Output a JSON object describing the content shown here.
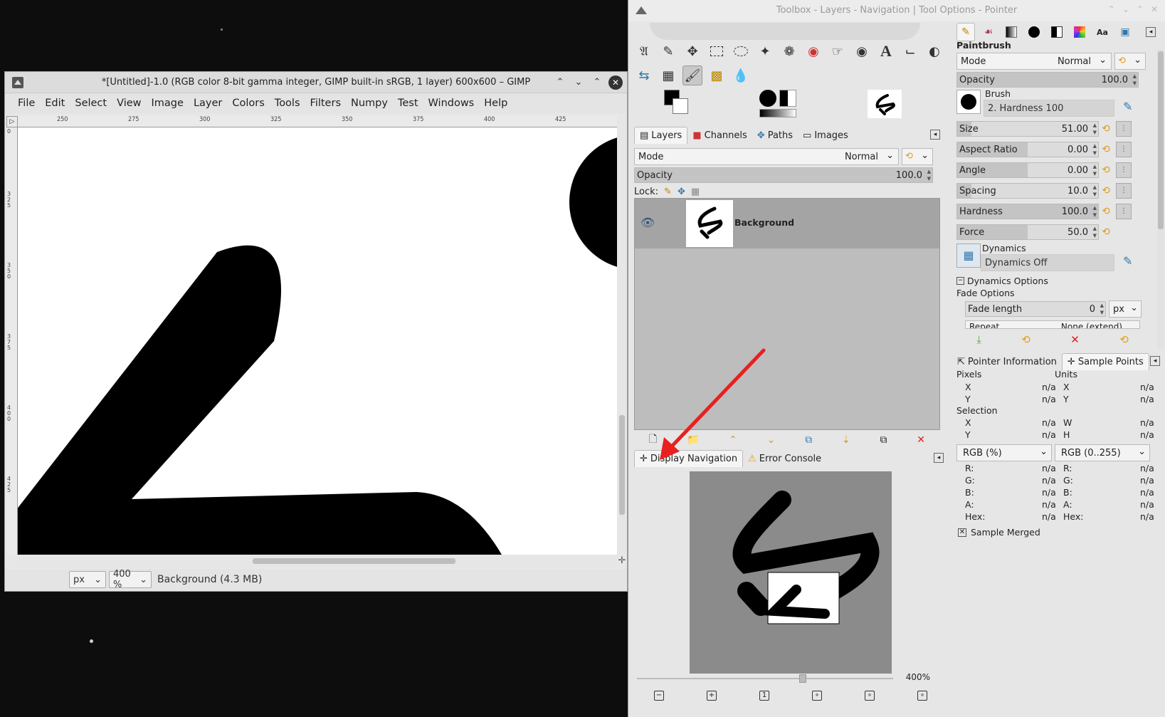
{
  "image_window": {
    "title": "*[Untitled]-1.0 (RGB color 8-bit gamma integer, GIMP built-in sRGB, 1 layer) 600x600 – GIMP",
    "menu": [
      "File",
      "Edit",
      "Select",
      "View",
      "Image",
      "Layer",
      "Colors",
      "Tools",
      "Filters",
      "Numpy",
      "Test",
      "Windows",
      "Help"
    ],
    "ruler_ticks": [
      "250",
      "275",
      "300",
      "325",
      "350",
      "375",
      "400",
      "425"
    ],
    "vruler_ticks": [
      "0",
      "325",
      "350",
      "375",
      "400",
      "425"
    ],
    "status": {
      "unit": "px",
      "zoom": "400 %",
      "info": "Background (4.3 MB)"
    }
  },
  "dock": {
    "title": "Toolbox - Layers - Navigation | Tool Options - Pointer",
    "tools_row1": [
      "paths-icon",
      "color-picker-icon",
      "move-icon",
      "rect-select-icon",
      "ellipse-select-icon",
      "fuzzy-select-icon",
      "free-select-icon",
      "foreground-select-icon",
      "warp-icon",
      "bucket-fill-icon",
      "text-icon",
      "crop-icon",
      "dodge-icon"
    ],
    "tools_row2": [
      "flip-icon",
      "cage-icon",
      "paintbrush-icon",
      "clone-icon",
      "smudge-icon"
    ],
    "layers_tabs": [
      "Layers",
      "Channels",
      "Paths",
      "Images"
    ],
    "layers": {
      "mode_label": "Mode",
      "mode_value": "Normal",
      "opacity_label": "Opacity",
      "opacity_value": "100.0",
      "lock_label": "Lock:",
      "layer_name": "Background"
    },
    "nav_tabs": [
      "Display Navigation",
      "Error Console"
    ],
    "nav_zoom": "400%"
  },
  "tool_options": {
    "tool_name": "Paintbrush",
    "mode_label": "Mode",
    "mode_value": "Normal",
    "opacity_label": "Opacity",
    "opacity_value": "100.0",
    "brush_label": "Brush",
    "brush_value": "2. Hardness 100",
    "sliders": [
      {
        "label": "Size",
        "value": "51.00",
        "fill": 0.1
      },
      {
        "label": "Aspect Ratio",
        "value": "0.00",
        "fill": 0.5
      },
      {
        "label": "Angle",
        "value": "0.00",
        "fill": 0.5
      },
      {
        "label": "Spacing",
        "value": "10.0",
        "fill": 0.1
      },
      {
        "label": "Hardness",
        "value": "100.0",
        "fill": 1.0
      },
      {
        "label": "Force",
        "value": "50.0",
        "fill": 0.5
      }
    ],
    "dynamics_label": "Dynamics",
    "dynamics_value": "Dynamics Off",
    "dynamics_options": "Dynamics Options",
    "fade_options": "Fade Options",
    "fade_length_label": "Fade length",
    "fade_length_value": "0",
    "fade_unit": "px",
    "repeat_label": "Repeat",
    "repeat_value": "None (extend)"
  },
  "pointer": {
    "tabs": [
      "Pointer Information",
      "Sample Points"
    ],
    "pixels": "Pixels",
    "units": "Units",
    "selection": "Selection",
    "na": "n/a",
    "rgb_pct": "RGB (%)",
    "rgb_255": "RGB (0..255)",
    "sample_merged": "Sample Merged",
    "channels": [
      "R:",
      "G:",
      "B:",
      "A:",
      "Hex:"
    ]
  },
  "colors": {
    "accent_red": "#e82020",
    "reset_orange": "#e29b1a"
  }
}
